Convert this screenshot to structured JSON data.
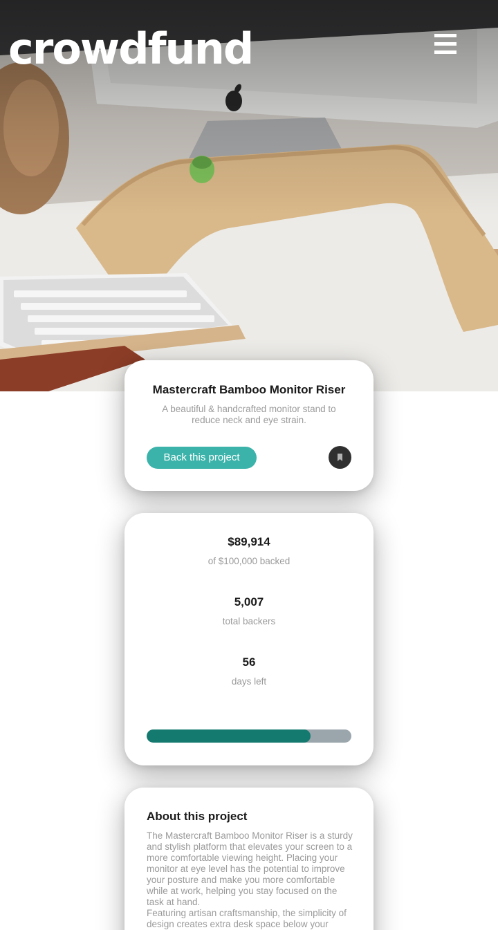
{
  "header": {
    "logo": "crowdfund",
    "menu_icon": "hamburger-menu-icon"
  },
  "project": {
    "title": "Mastercraft Bamboo Monitor Riser",
    "description": "A beautiful & handcrafted monitor stand to reduce neck and eye strain.",
    "back_label": "Back this project",
    "bookmark_icon": "bookmark-icon"
  },
  "stats": {
    "amount": "$89,914",
    "amount_label": "of $100,000 backed",
    "backers": "5,007",
    "backers_label": "total backers",
    "days": "56",
    "days_label": "days left",
    "progress_fraction": 0.8
  },
  "about": {
    "title": "About this project",
    "paragraph_1": "The Mastercraft Bamboo Monitor Riser is a sturdy and stylish platform that elevates your screen to a more comfortable viewing height. Placing your monitor at eye level has the potential to improve your posture and make you more comfortable while at work, helping you stay focused on the task at hand.",
    "paragraph_2": "Featuring artisan craftsmanship, the simplicity of design creates extra desk space below your"
  },
  "colors": {
    "accent": "#3cb3aa",
    "accent_dark": "#147a6f",
    "progress_track": "#9aa6ab",
    "muted_text": "#9a9a9a"
  }
}
